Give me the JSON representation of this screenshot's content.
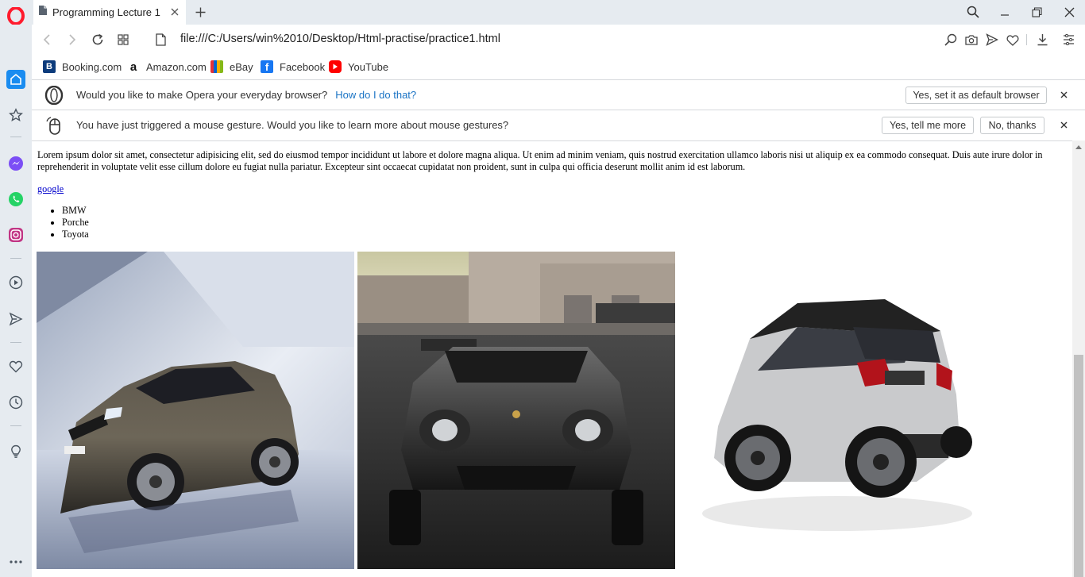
{
  "browser": {
    "tab": {
      "title": "Programming Lecture 1"
    },
    "address": {
      "url": "file:///C:/Users/win%2010/Desktop/Html-practise/practice1.html"
    },
    "bookmarks": [
      {
        "label": "Booking.com",
        "icon": "booking-icon"
      },
      {
        "label": "Amazon.com",
        "icon": "amazon-icon"
      },
      {
        "label": "eBay",
        "icon": "ebay-icon"
      },
      {
        "label": "Facebook",
        "icon": "facebook-icon"
      },
      {
        "label": "YouTube",
        "icon": "youtube-icon"
      }
    ],
    "accent": "#ff1b2d"
  },
  "infobar_default": {
    "message": "Would you like to make Opera your everyday browser?",
    "link": "How do I do that?",
    "button": "Yes, set it as default browser",
    "close": "×"
  },
  "infobar_gesture": {
    "message": "You have just triggered a mouse gesture. Would you like to learn more about mouse gestures?",
    "yes_button": "Yes, tell me more",
    "no_button": "No, thanks",
    "close": "×"
  },
  "page": {
    "paragraph": "Lorem ipsum dolor sit amet, consectetur adipisicing elit, sed do eiusmod tempor incididunt ut labore et dolore magna aliqua. Ut enim ad minim veniam, quis nostrud exercitation ullamco laboris nisi ut aliquip ex ea commodo consequat. Duis aute irure dolor in reprehenderit in voluptate velit esse cillum dolore eu fugiat nulla pariatur. Excepteur sint occaecat cupidatat non proident, sunt in culpa qui officia deserunt mollit anim id est laborum.",
    "link_text": "google",
    "list": [
      "BMW",
      "Porche",
      "Toyota"
    ],
    "images": [
      "bmw-suv-image",
      "porsche-carrera-image",
      "toyota-chr-image"
    ]
  }
}
